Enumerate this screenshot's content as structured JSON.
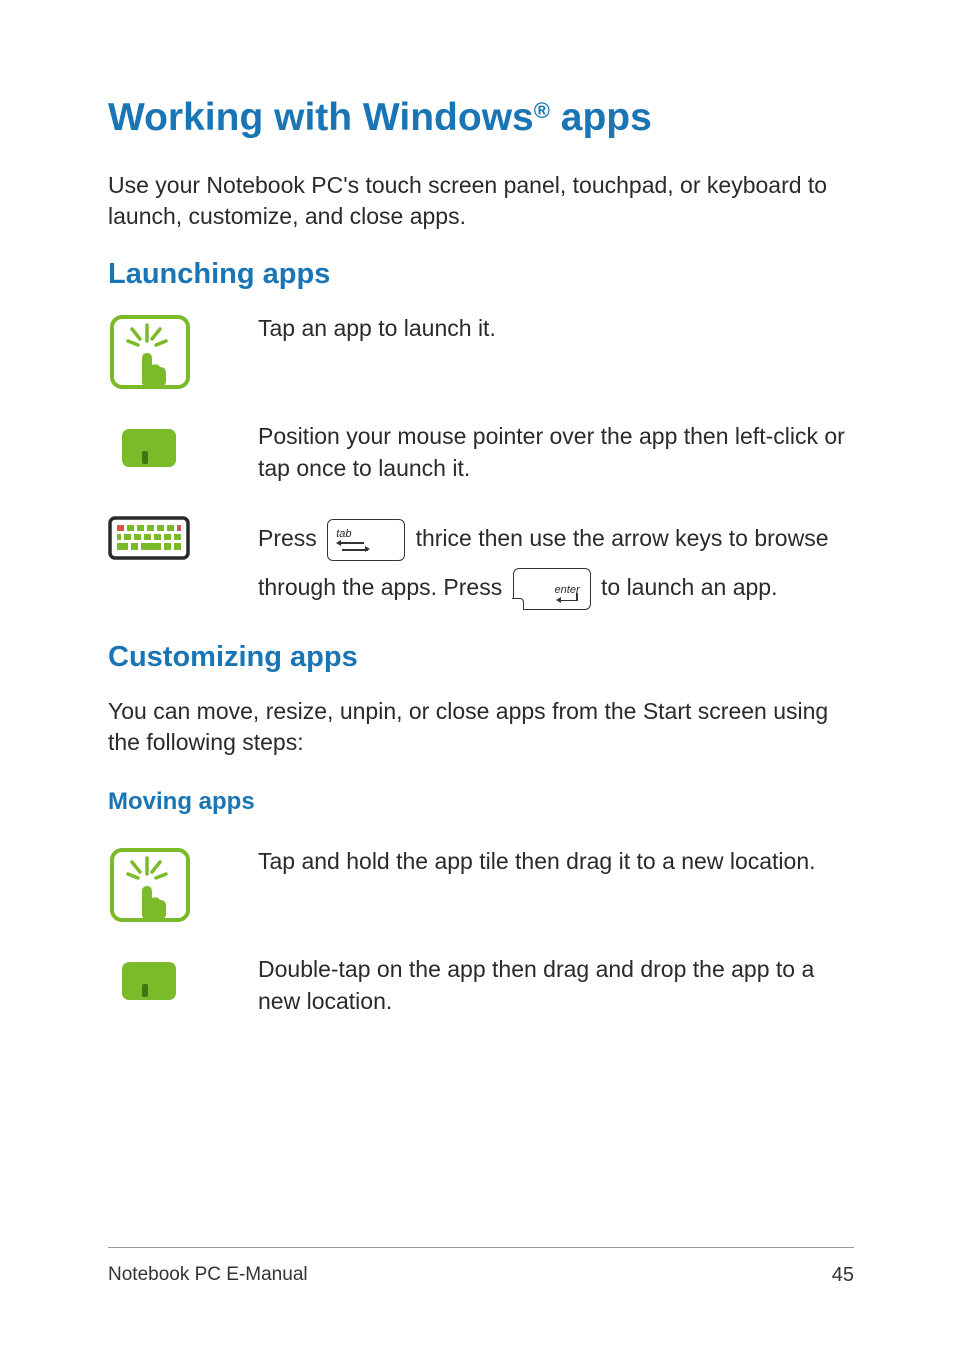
{
  "title": {
    "pre": "Working with Windows",
    "reg": "®",
    "post": " apps"
  },
  "intro": "Use your Notebook PC's touch screen panel, touchpad, or keyboard to launch, customize, and close apps.",
  "launching": {
    "heading": "Launching apps",
    "touch": "Tap an app to launch it.",
    "touchpad": "Position your mouse pointer over the app then left-click or tap once to launch it.",
    "keyboard": {
      "pre": "Press ",
      "tabKeyLabel": "tab",
      "mid": " thrice then use the arrow keys to browse through the apps. Press ",
      "enterKeyLabel": "enter",
      "post": " to launch an app."
    }
  },
  "customizing": {
    "heading": "Customizing apps",
    "intro": "You can move, resize, unpin, or close apps from the Start screen using the following steps:",
    "moving": {
      "heading": "Moving apps",
      "touch": "Tap and hold the app tile then drag it to a new location.",
      "touchpad": "Double-tap on the app then drag and drop the app to a new location."
    }
  },
  "footer": {
    "label": "Notebook PC E-Manual",
    "page": "45"
  }
}
